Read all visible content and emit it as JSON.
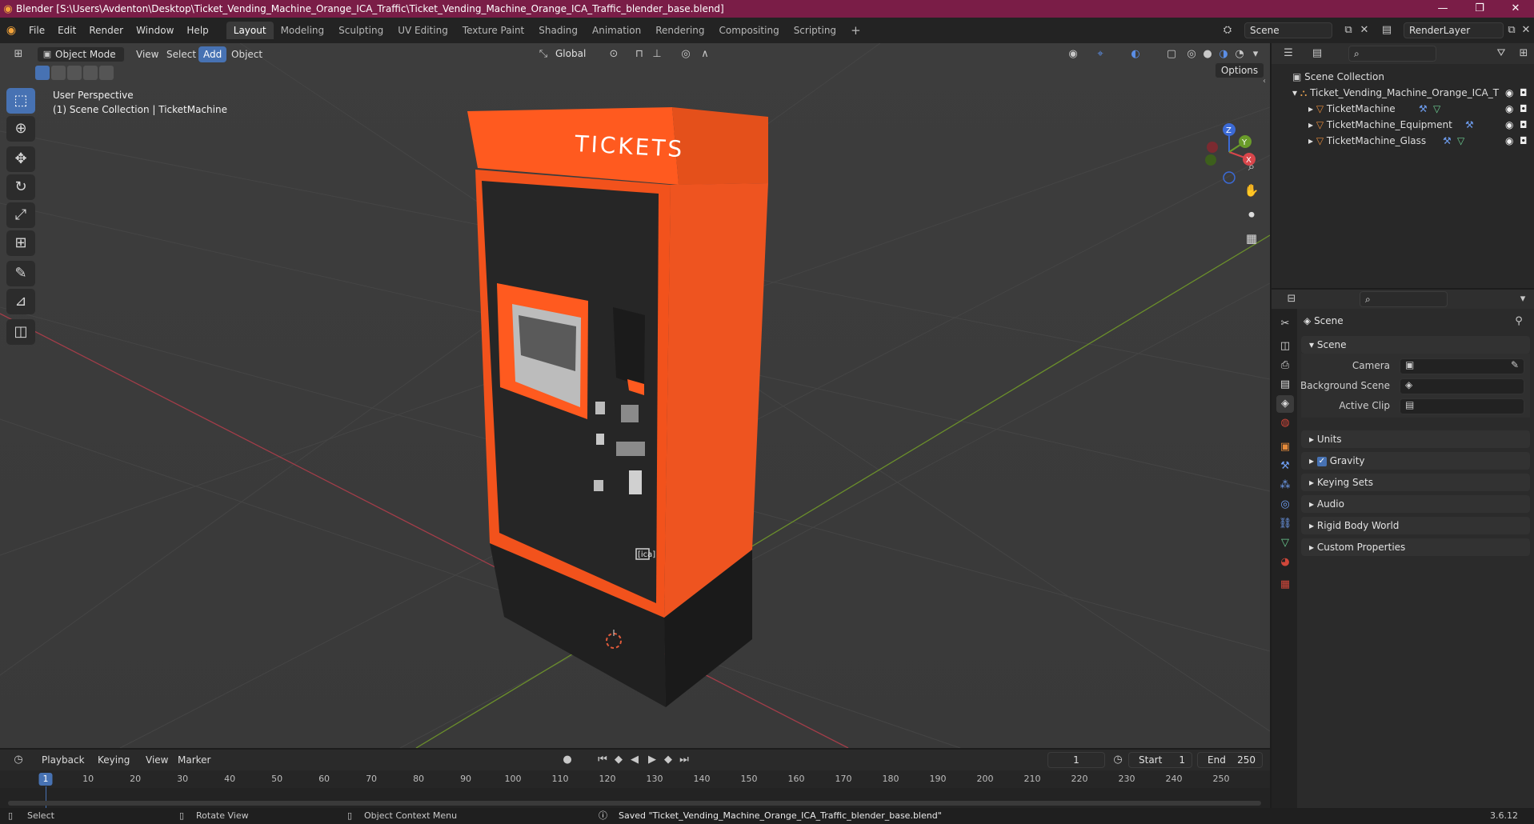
{
  "window": {
    "title": "Blender [S:\\Users\\Avdenton\\Desktop\\Ticket_Vending_Machine_Orange_ICA_Traffic\\Ticket_Vending_Machine_Orange_ICA_Traffic_blender_base.blend]",
    "minimize_icon": "minimize-icon",
    "maximize_icon": "maximize-icon",
    "close_icon": "close-icon"
  },
  "menubar": {
    "items": [
      "File",
      "Edit",
      "Render",
      "Window",
      "Help"
    ]
  },
  "workspaces": {
    "tabs": [
      "Layout",
      "Modeling",
      "Sculpting",
      "UV Editing",
      "Texture Paint",
      "Shading",
      "Animation",
      "Rendering",
      "Compositing",
      "Scripting"
    ],
    "active": "Layout"
  },
  "scene_selector": {
    "value": "Scene"
  },
  "view_layer": {
    "value": "RenderLayer"
  },
  "viewport_header": {
    "mode": "Object Mode",
    "menus": [
      "View",
      "Select",
      "Add",
      "Object"
    ],
    "active_menu": "Add",
    "transform_orientation": "Global",
    "options_label": "Options"
  },
  "viewport": {
    "overlay_line1": "User Perspective",
    "overlay_line2": "(1) Scene Collection | TicketMachine",
    "machine_sign": "TICKETS",
    "machine_logo": "[ica]",
    "gizmo_axes": [
      "X",
      "Y",
      "Z"
    ]
  },
  "tools": [
    "select-box-icon",
    "cursor-icon",
    "move-icon",
    "rotate-icon",
    "scale-icon",
    "transform-icon",
    "annotate-icon",
    "measure-icon",
    "add-cube-icon"
  ],
  "outliner": {
    "root": "Scene Collection",
    "collection": "Ticket_Vending_Machine_Orange_ICA_T",
    "objects": [
      "TicketMachine",
      "TicketMachine_Equipment",
      "TicketMachine_Glass"
    ]
  },
  "properties": {
    "context_title": "Scene",
    "scene_panel": "Scene",
    "fields": [
      {
        "label": "Camera"
      },
      {
        "label": "Background Scene"
      },
      {
        "label": "Active Clip"
      }
    ],
    "panels": [
      "Units",
      "Gravity",
      "Keying Sets",
      "Audio",
      "Rigid Body World",
      "Custom Properties"
    ],
    "gravity_checked": true
  },
  "timeline": {
    "menus": [
      "Playback",
      "Keying",
      "View",
      "Marker"
    ],
    "current_frame": "1",
    "start_label": "Start",
    "start_value": "1",
    "end_label": "End",
    "end_value": "250",
    "ruler": [
      "1",
      "10",
      "20",
      "30",
      "40",
      "50",
      "60",
      "70",
      "80",
      "90",
      "100",
      "110",
      "120",
      "130",
      "140",
      "150",
      "160",
      "170",
      "180",
      "190",
      "200",
      "210",
      "220",
      "230",
      "240",
      "250"
    ]
  },
  "statusbar": {
    "select": "Select",
    "rotate": "Rotate View",
    "context_menu": "Object Context Menu",
    "message": "Saved \"Ticket_Vending_Machine_Orange_ICA_Traffic_blender_base.blend\"",
    "version": "3.6.12"
  },
  "colors": {
    "title_bg": "#7a1d47",
    "accent": "#4772b3",
    "machine_orange": "#f2521c"
  }
}
